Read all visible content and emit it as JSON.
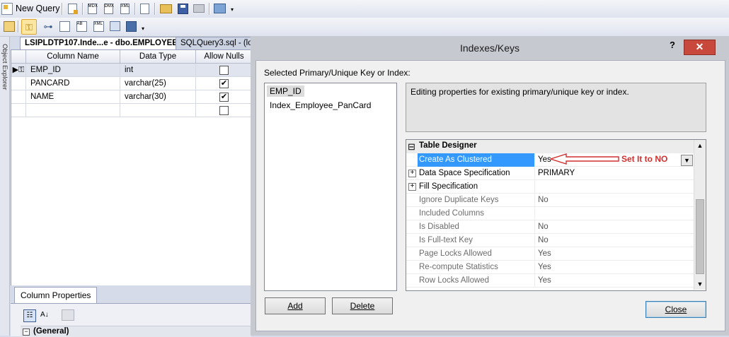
{
  "toolbar": {
    "new_query_label": "New Query"
  },
  "tabs": {
    "active": "LSIPLDTP107.Inde...e - dbo.EMPLOYEE",
    "inactive": "SQLQuery3.sql - (lo"
  },
  "object_explorer_label": "Object Explorer",
  "grid": {
    "headers": [
      "Column Name",
      "Data Type",
      "Allow Nulls"
    ],
    "rows": [
      {
        "name": "EMP_ID",
        "type": "int",
        "nulls": ""
      },
      {
        "name": "PANCARD",
        "type": "varchar(25)",
        "nulls": "✔"
      },
      {
        "name": "NAME",
        "type": "varchar(30)",
        "nulls": "✔"
      }
    ]
  },
  "column_properties": {
    "tab_label": "Column Properties",
    "section": "(General)"
  },
  "dialog": {
    "title": "Indexes/Keys",
    "help": "?",
    "close_x": "✕",
    "selected_label": "Selected Primary/Unique Key or Index:",
    "keys": [
      "EMP_ID",
      "Index_Employee_PanCard"
    ],
    "description": "Editing properties for existing primary/unique key or index.",
    "section": "Table Designer",
    "section_toggle": "⊟",
    "properties": [
      {
        "name": "Create As Clustered",
        "value": "Yes"
      },
      {
        "name": "Data Space Specification",
        "value": "PRIMARY"
      },
      {
        "name": "Fill Specification",
        "value": ""
      },
      {
        "name": "Ignore Duplicate Keys",
        "value": "No"
      },
      {
        "name": "Included Columns",
        "value": ""
      },
      {
        "name": "Is Disabled",
        "value": "No"
      },
      {
        "name": "Is Full-text Key",
        "value": "No"
      },
      {
        "name": "Page Locks Allowed",
        "value": "Yes"
      },
      {
        "name": "Re-compute Statistics",
        "value": "Yes"
      },
      {
        "name": "Row Locks Allowed",
        "value": "Yes"
      }
    ],
    "annotation": "Set It to NO",
    "add_button": "Add",
    "delete_button": "Delete",
    "close_button": "Close",
    "colors": {
      "selected_row": "#3399ff",
      "annotation": "#d32f2f",
      "close_button": "#c9483c"
    }
  }
}
